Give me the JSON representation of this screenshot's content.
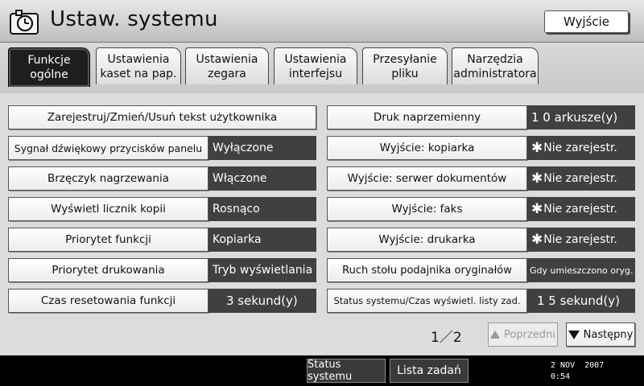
{
  "window": {
    "title": "Ustaw. systemu",
    "exit_label": "Wyjście"
  },
  "tabs": [
    {
      "label": "Funkcje\nogólne",
      "active": true
    },
    {
      "label": "Ustawienia\nkaset na pap.",
      "active": false
    },
    {
      "label": "Ustawienia\nzegara",
      "active": false
    },
    {
      "label": "Ustawienia\ninterfejsu",
      "active": false
    },
    {
      "label": "Przesyłanie\npliku",
      "active": false
    },
    {
      "label": "Narzędzia\nadministratora",
      "active": false
    }
  ],
  "left_settings": [
    {
      "label": "Zarejestruj/Zmień/Usuń tekst użytkownika",
      "value": ""
    },
    {
      "label": "Sygnał dźwiękowy przycisków panelu",
      "value": "Wyłączone"
    },
    {
      "label": "Brzęczyk nagrzewania",
      "value": "Włączone"
    },
    {
      "label": "Wyświetl licznik kopii",
      "value": "Rosnąco"
    },
    {
      "label": "Priorytet funkcji",
      "value": "Kopiarka"
    },
    {
      "label": "Priorytet drukowania",
      "value": "Tryb wyświetlania"
    },
    {
      "label": "Czas resetowania funkcji",
      "value": "3 sekund(y)"
    }
  ],
  "right_settings": [
    {
      "label": "Druk naprzemienny",
      "value": "1 0 arkusze(y)"
    },
    {
      "label": "Wyjście: kopiarka",
      "mark": "✱",
      "value": "Nie zarejestr."
    },
    {
      "label": "Wyjście: serwer dokumentów",
      "mark": "✱",
      "value": "Nie zarejestr."
    },
    {
      "label": "Wyjście: faks",
      "mark": "✱",
      "value": "Nie zarejestr."
    },
    {
      "label": "Wyjście: drukarka",
      "mark": "✱",
      "value": "Nie zarejestr."
    },
    {
      "label": "Ruch stołu podajnika oryginałów",
      "value": "Gdy umieszczono oryg."
    },
    {
      "label": "Status systemu/Czas wyświetl. listy zad.",
      "value": "1 5 sekund(y)"
    }
  ],
  "pagination": {
    "indicator": "1／2",
    "prev_label": "Poprzedni",
    "next_label": "Następny"
  },
  "bottom_bar": {
    "status_label": "Status systemu",
    "jobs_label": "Lista zadań",
    "date": "2 NOV  2007",
    "time": "0:54"
  },
  "icons": {
    "title": "settings-clock-icon",
    "prev": "triangle-up-icon",
    "next": "triangle-down-icon"
  }
}
